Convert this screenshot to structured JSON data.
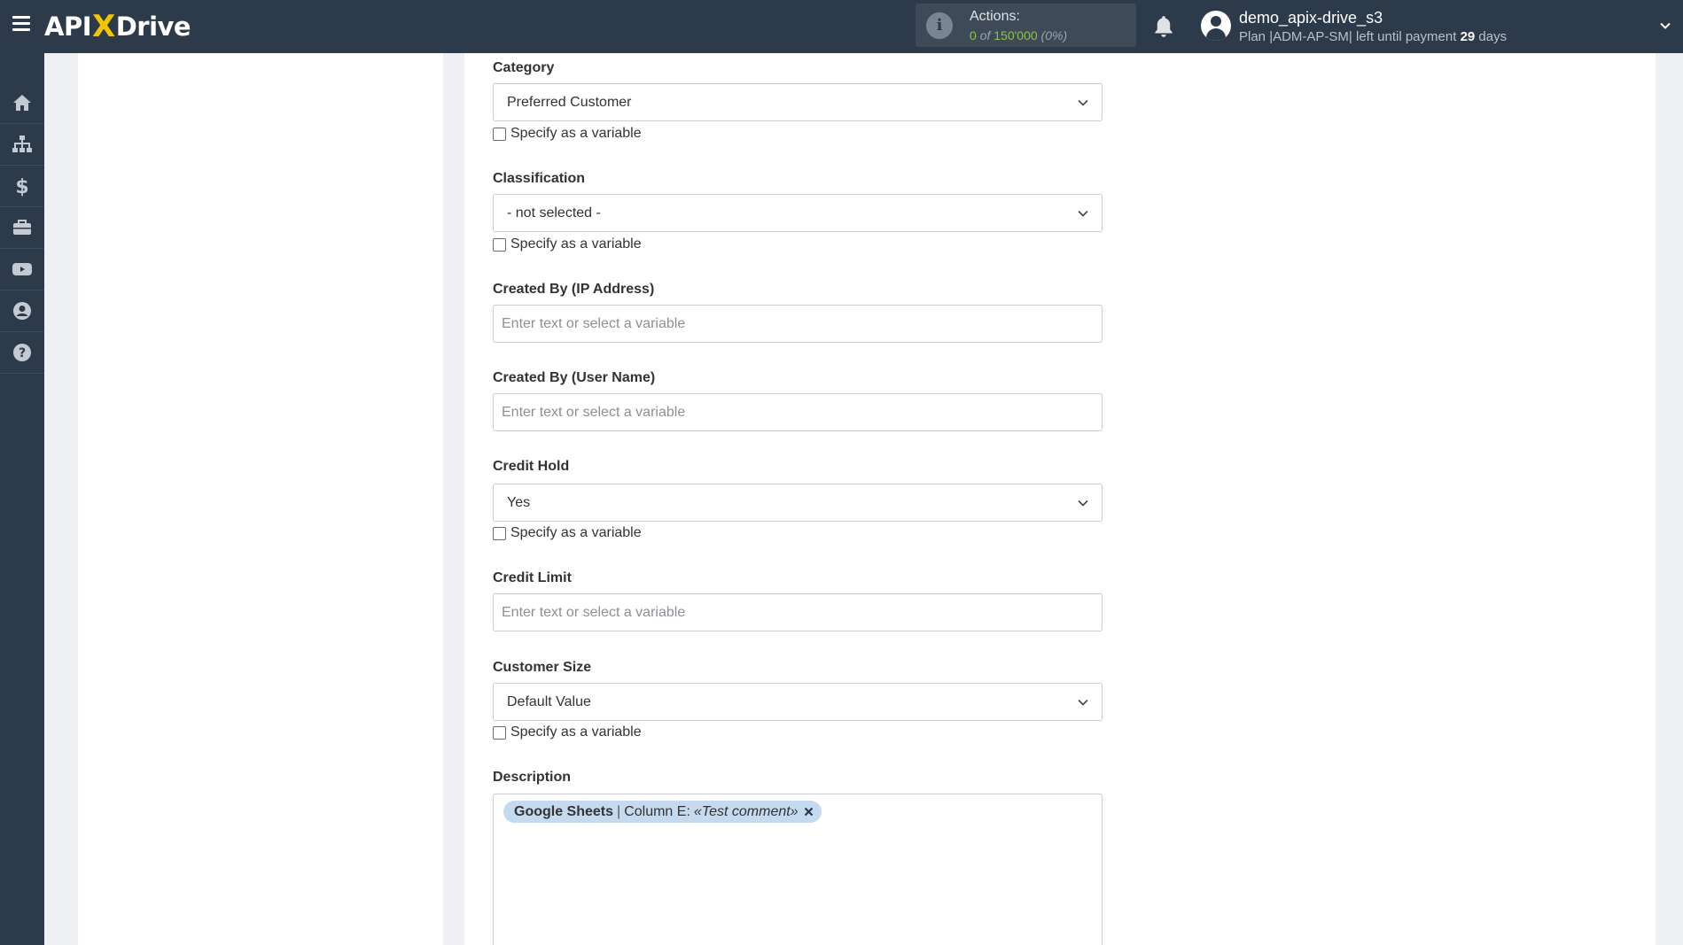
{
  "header": {
    "logo_left": "API",
    "logo_x": "X",
    "logo_right": "Drive",
    "actions_label": "Actions:",
    "actions_used": "0",
    "actions_of": "of",
    "actions_total": "150'000",
    "actions_percent": "(0%)",
    "user_name": "demo_apix-drive_s3",
    "plan_prefix": "Plan |ADM-AP-SM| left until payment",
    "plan_days": "29",
    "plan_suffix": "days"
  },
  "sidebar": {
    "items": [
      "home-icon",
      "sitemap-icon",
      "dollar-icon",
      "briefcase-icon",
      "video-icon",
      "user-circle-icon",
      "help-icon"
    ]
  },
  "form": {
    "category": {
      "label": "Category",
      "value": "Preferred Customer",
      "variable_label": "Specify as a variable"
    },
    "classification": {
      "label": "Classification",
      "value": "- not selected -",
      "variable_label": "Specify as a variable"
    },
    "created_by_ip": {
      "label": "Created By (IP Address)",
      "placeholder": "Enter text or select a variable"
    },
    "created_by_user": {
      "label": "Created By (User Name)",
      "placeholder": "Enter text or select a variable"
    },
    "credit_hold": {
      "label": "Credit Hold",
      "value": "Yes",
      "variable_label": "Specify as a variable"
    },
    "credit_limit": {
      "label": "Credit Limit",
      "placeholder": "Enter text or select a variable"
    },
    "customer_size": {
      "label": "Customer Size",
      "value": "Default Value",
      "variable_label": "Specify as a variable"
    },
    "description": {
      "label": "Description",
      "tag_source": "Google Sheets",
      "tag_separator": "|",
      "tag_column": "Column E:",
      "tag_value": "«Test comment»"
    }
  },
  "colors": {
    "topbar": "#2c3a4a",
    "accent_yellow": "#f5c400",
    "actions_green": "#8bc34a",
    "tag_bg": "#c5d9ef"
  }
}
